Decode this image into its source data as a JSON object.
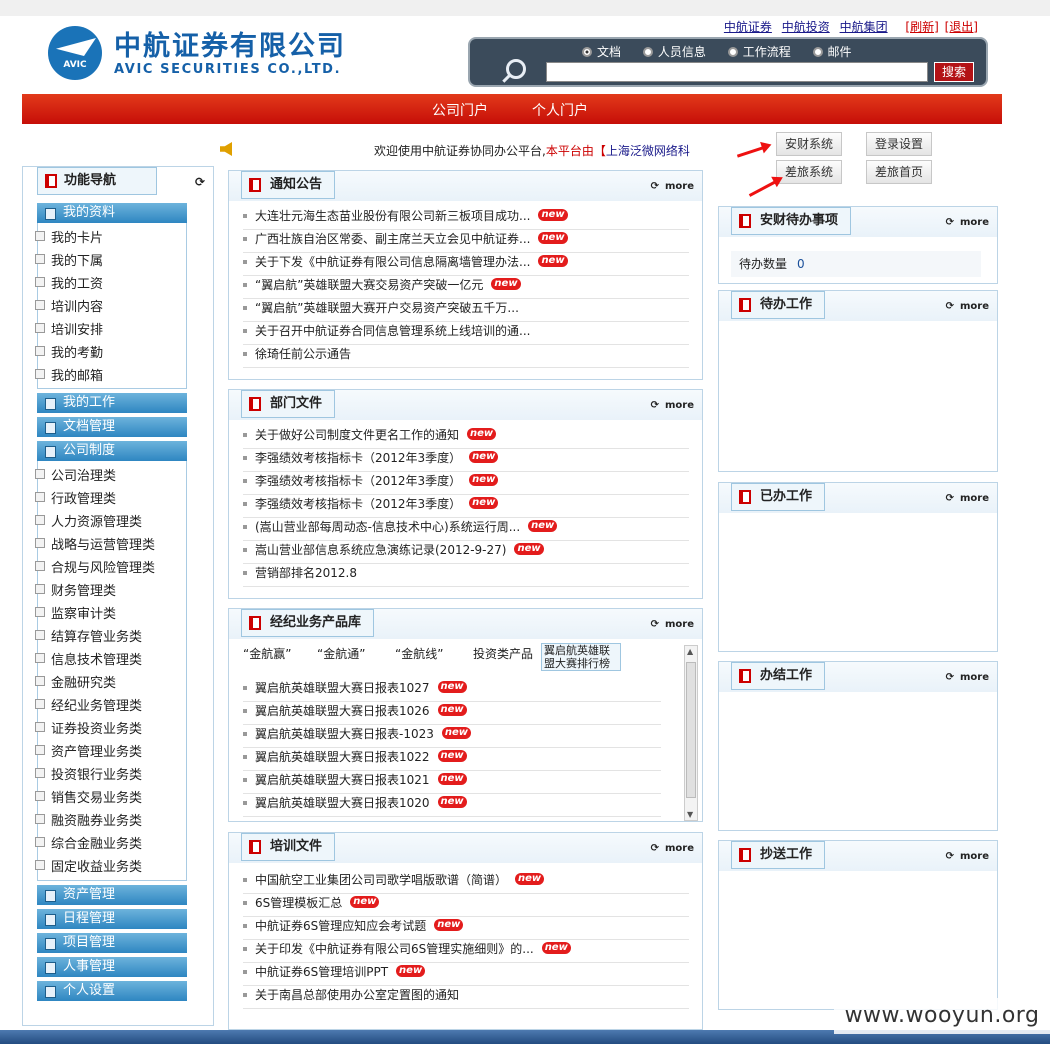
{
  "header": {
    "logo_cn": "中航证券有限公司",
    "logo_en": "AVIC SECURITIES CO.,LTD.",
    "logo_badge": "AVIC",
    "links": [
      "中航证券",
      "中航投资",
      "中航集团"
    ],
    "refresh": "[刷新]",
    "logout": "[退出]"
  },
  "search": {
    "options": [
      "文档",
      "人员信息",
      "工作流程",
      "邮件"
    ],
    "selected": "文档",
    "button": "搜索",
    "value": ""
  },
  "nav": {
    "portal": "公司门户",
    "personal": "个人门户"
  },
  "welcome": {
    "text_prefix": "欢迎使用中航证券协同办公平台,",
    "text_red": "本平台由【",
    "text_blue": "上海泛微网络科"
  },
  "quick_buttons": {
    "b1": "安财系统",
    "b2": "登录设置",
    "b3": "差旅系统",
    "b4": "差旅首页"
  },
  "sidebar": {
    "title": "功能导航",
    "g_profile": "我的资料",
    "profile_items": [
      "我的卡片",
      "我的下属",
      "我的工资",
      "培训内容",
      "培训安排",
      "我的考勤",
      "我的邮箱"
    ],
    "g_work": "我的工作",
    "g_docs": "文档管理",
    "g_policy": "公司制度",
    "policy_items": [
      "公司治理类",
      "行政管理类",
      "人力资源管理类",
      "战略与运营管理类",
      "合规与风险管理类",
      "财务管理类",
      "监察审计类",
      "结算存管业务类",
      "信息技术管理类",
      "金融研究类",
      "经纪业务管理类",
      "证券投资业务类",
      "资产管理业务类",
      "投资银行业务类",
      "销售交易业务类",
      "融资融券业务类",
      "综合金融业务类",
      "固定收益业务类"
    ],
    "g_asset": "资产管理",
    "g_schedule": "日程管理",
    "g_project": "项目管理",
    "g_hr": "人事管理",
    "g_personal": "个人设置"
  },
  "more": "more",
  "new_tag": "new",
  "notices": {
    "title": "通知公告",
    "items": [
      {
        "text": "大连壮元海生态苗业股份有限公司新三板项目成功...",
        "new": true
      },
      {
        "text": "广西壮族自治区常委、副主席兰天立会见中航证券...",
        "new": true
      },
      {
        "text": "关于下发《中航证券有限公司信息隔离墙管理办法...",
        "new": true
      },
      {
        "text": "“翼启航”英雄联盟大赛交易资产突破一亿元",
        "new": true
      },
      {
        "text": "“翼启航”英雄联盟大赛开户交易资产突破五千万...",
        "new": false
      },
      {
        "text": "关于召开中航证券合同信息管理系统上线培训的通...",
        "new": false
      },
      {
        "text": "徐琦任前公示通告",
        "new": false
      }
    ]
  },
  "dept_docs": {
    "title": "部门文件",
    "items": [
      {
        "text": "关于做好公司制度文件更名工作的通知",
        "new": true
      },
      {
        "text": "李强绩效考核指标卡（2012年3季度）",
        "new": true
      },
      {
        "text": "李强绩效考核指标卡（2012年3季度）",
        "new": true
      },
      {
        "text": "李强绩效考核指标卡（2012年3季度）",
        "new": true
      },
      {
        "text": "(嵩山营业部每周动态-信息技术中心)系统运行周...",
        "new": true
      },
      {
        "text": "嵩山营业部信息系统应急演练记录(2012-9-27)",
        "new": true
      },
      {
        "text": "营销部排名2012.8",
        "new": false
      }
    ]
  },
  "products": {
    "title": "经纪业务产品库",
    "tabs": [
      "“金航赢”",
      "“金航通”",
      "“金航线”",
      "投资类产品",
      "翼启航英雄联盟大赛排行榜"
    ],
    "items": [
      {
        "text": "翼启航英雄联盟大赛日报表1027",
        "new": true
      },
      {
        "text": "翼启航英雄联盟大赛日报表1026",
        "new": true
      },
      {
        "text": "翼启航英雄联盟大赛日报表-1023",
        "new": true
      },
      {
        "text": "翼启航英雄联盟大赛日报表1022",
        "new": true
      },
      {
        "text": "翼启航英雄联盟大赛日报表1021",
        "new": true
      },
      {
        "text": "翼启航英雄联盟大赛日报表1020",
        "new": true
      }
    ]
  },
  "training": {
    "title": "培训文件",
    "items": [
      {
        "text": "中国航空工业集团公司司歌学唱版歌谱（简谱）",
        "new": true
      },
      {
        "text": "6S管理模板汇总",
        "new": true
      },
      {
        "text": "中航证券6S管理应知应会考试题",
        "new": true
      },
      {
        "text": "关于印发《中航证券有限公司6S管理实施细则》的...",
        "new": true
      },
      {
        "text": "中航证券6S管理培训PPT",
        "new": true
      },
      {
        "text": "关于南昌总部使用办公室定置图的通知",
        "new": false
      }
    ]
  },
  "right": {
    "anc_title": "安财待办事项",
    "anc_label": "待办数量",
    "anc_count": "0",
    "todo": "待办工作",
    "done": "已办工作",
    "finished": "办结工作",
    "cc": "抄送工作"
  },
  "watermark": "www.wooyun.org"
}
